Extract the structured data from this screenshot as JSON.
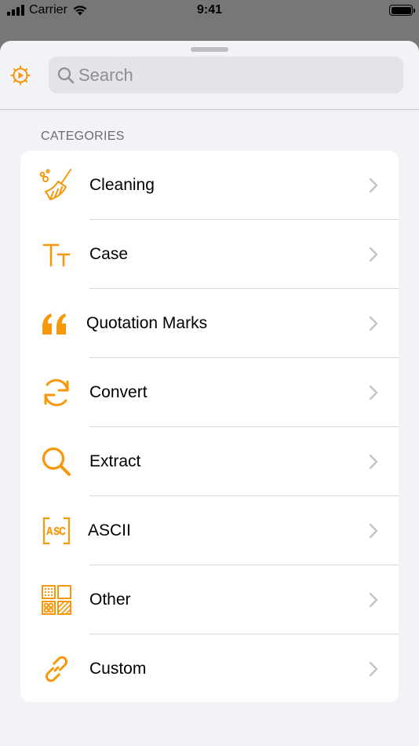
{
  "status_bar": {
    "carrier": "Carrier",
    "time": "9:41"
  },
  "search": {
    "placeholder": "Search",
    "value": ""
  },
  "section": {
    "header": "CATEGORIES"
  },
  "categories": [
    {
      "label": "Cleaning",
      "icon": "broom-icon"
    },
    {
      "label": "Case",
      "icon": "text-case-icon"
    },
    {
      "label": "Quotation Marks",
      "icon": "quote-icon"
    },
    {
      "label": "Convert",
      "icon": "convert-arrows-icon"
    },
    {
      "label": "Extract",
      "icon": "magnifier-icon"
    },
    {
      "label": "ASCII",
      "icon": "ascii-icon"
    },
    {
      "label": "Other",
      "icon": "grid-icon"
    },
    {
      "label": "Custom",
      "icon": "link-icon"
    }
  ],
  "colors": {
    "accent": "#f7970a",
    "sheet_background": "#f2f2f7",
    "dimmed_background": "#777777"
  }
}
